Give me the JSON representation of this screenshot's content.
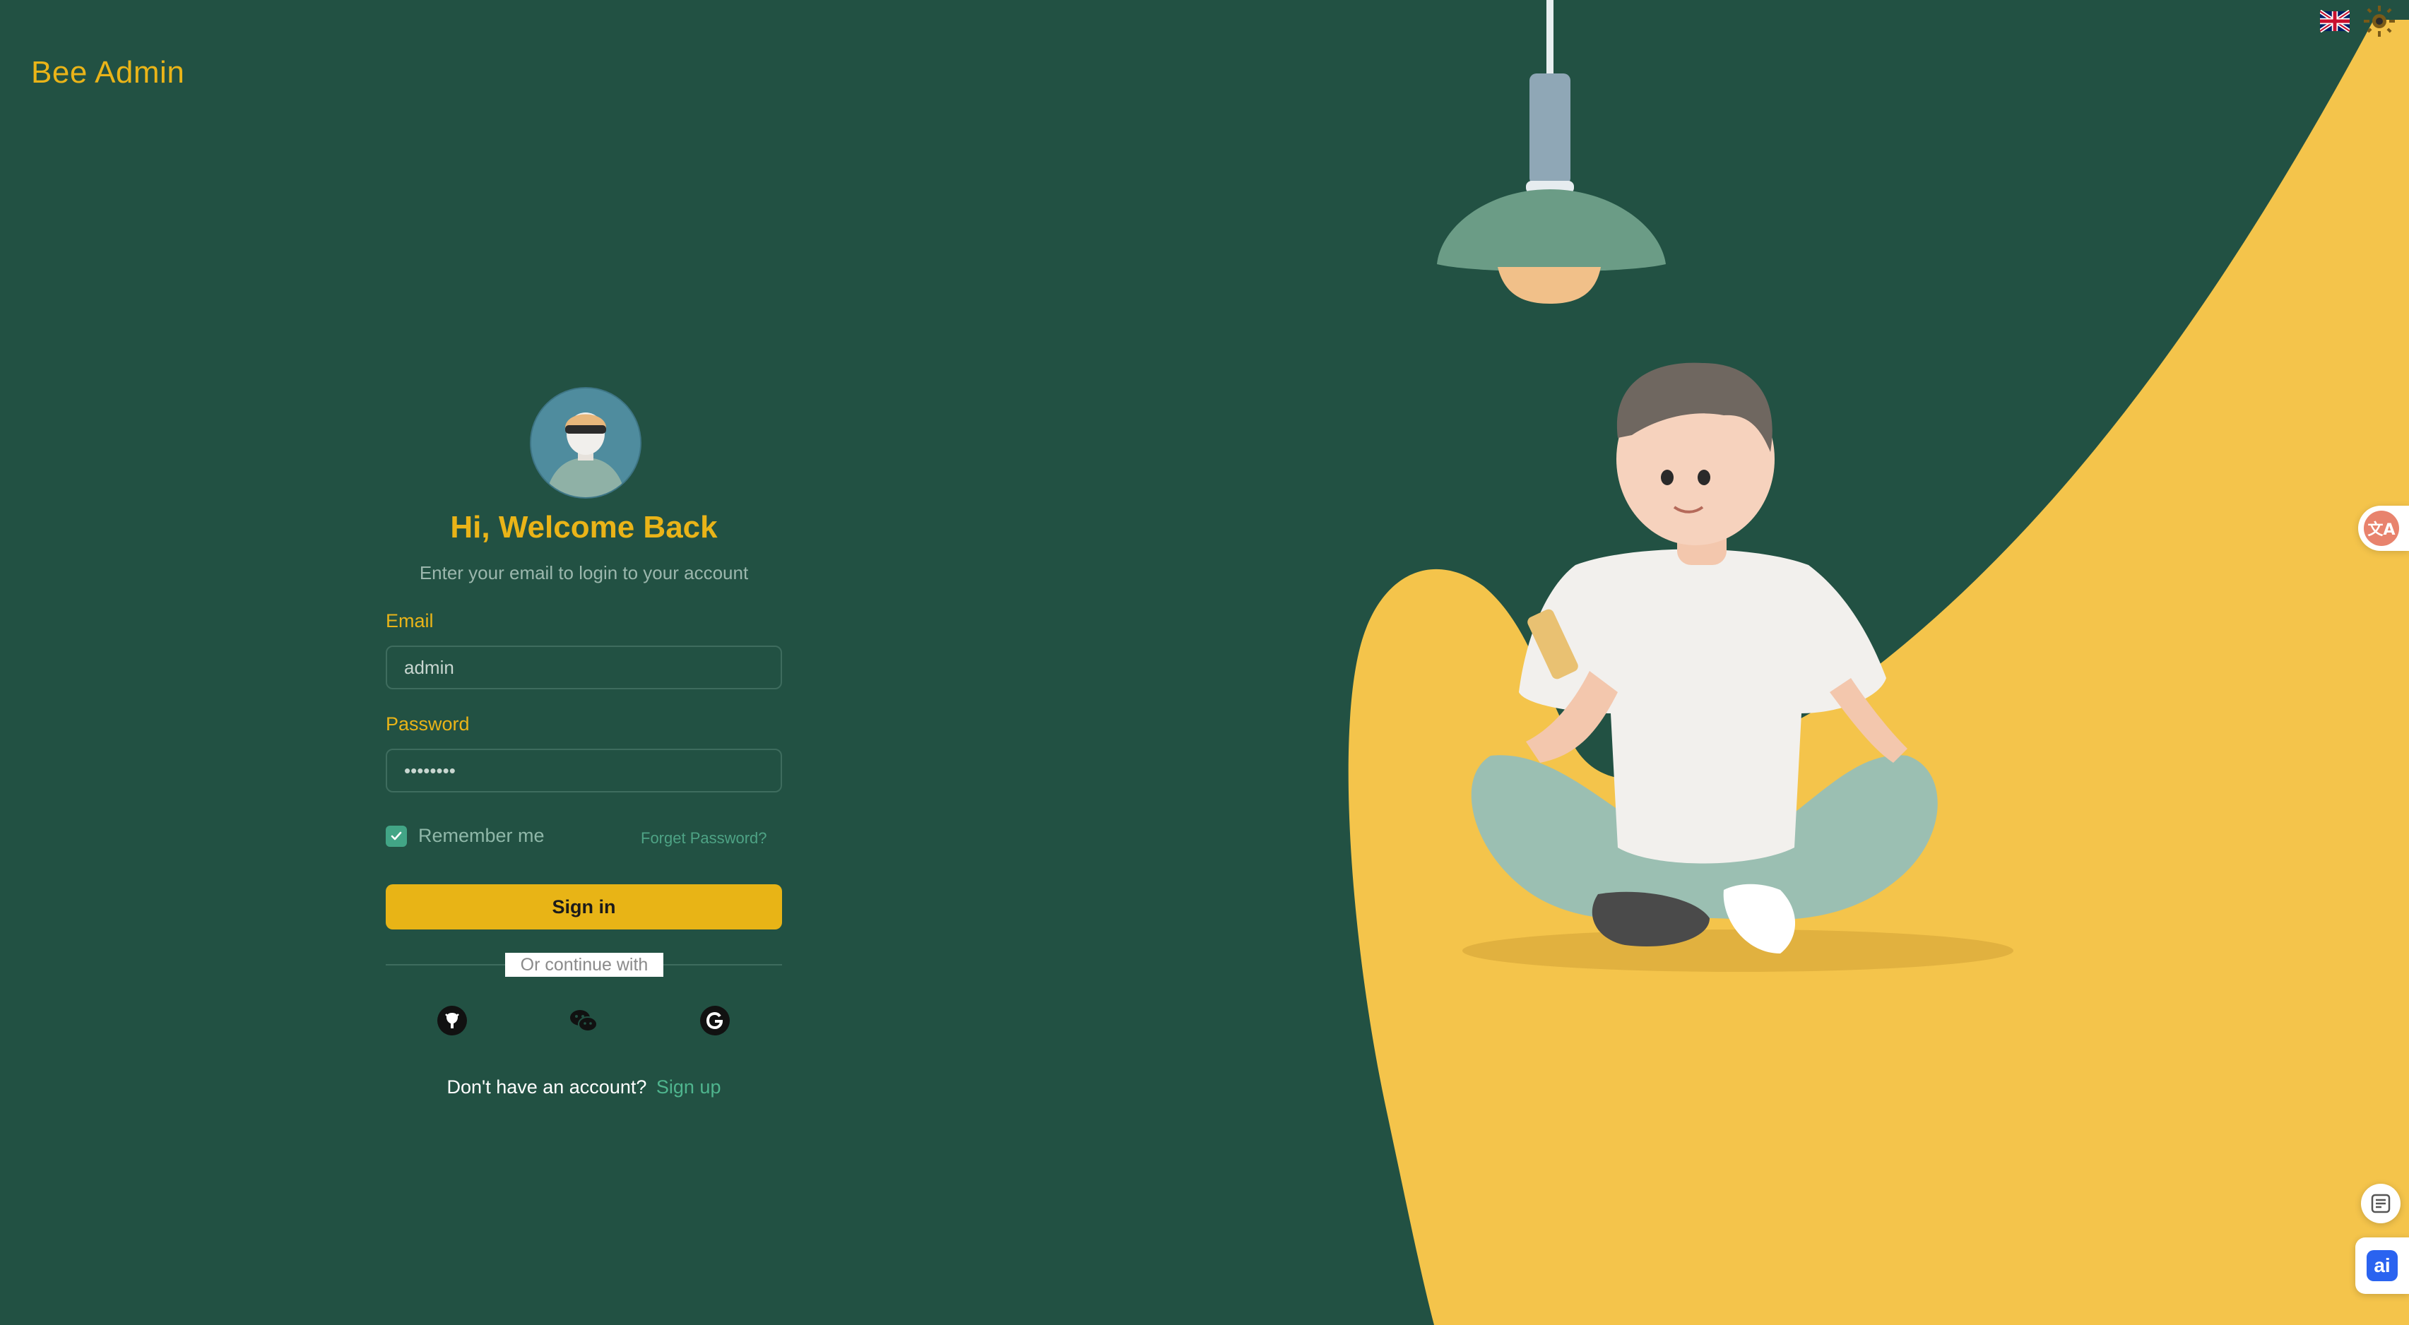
{
  "brand": {
    "name": "Bee Admin"
  },
  "header": {
    "language_icon": "uk-flag-icon",
    "theme_icon": "sun-icon"
  },
  "login": {
    "title": "Hi, Welcome Back",
    "subtitle": "Enter your email to login to your account",
    "email_label": "Email",
    "email_value": "admin",
    "password_label": "Password",
    "password_value": "••••••••",
    "remember_label": "Remember me",
    "remember_checked": true,
    "forget_label": "Forget Password?",
    "signin_label": "Sign in",
    "divider_text": "Or continue with",
    "social": [
      "github-icon",
      "wechat-icon",
      "google-icon"
    ],
    "no_account_text": "Don't have an account?",
    "signup_label": "Sign up"
  },
  "floating": {
    "translate_icon": "translate-icon",
    "notes_icon": "notes-icon",
    "ai_label": "ai"
  },
  "colors": {
    "background": "#225143",
    "accent": "#eab418",
    "link": "#4fb58e",
    "illustration_yellow": "#f4c44b"
  }
}
